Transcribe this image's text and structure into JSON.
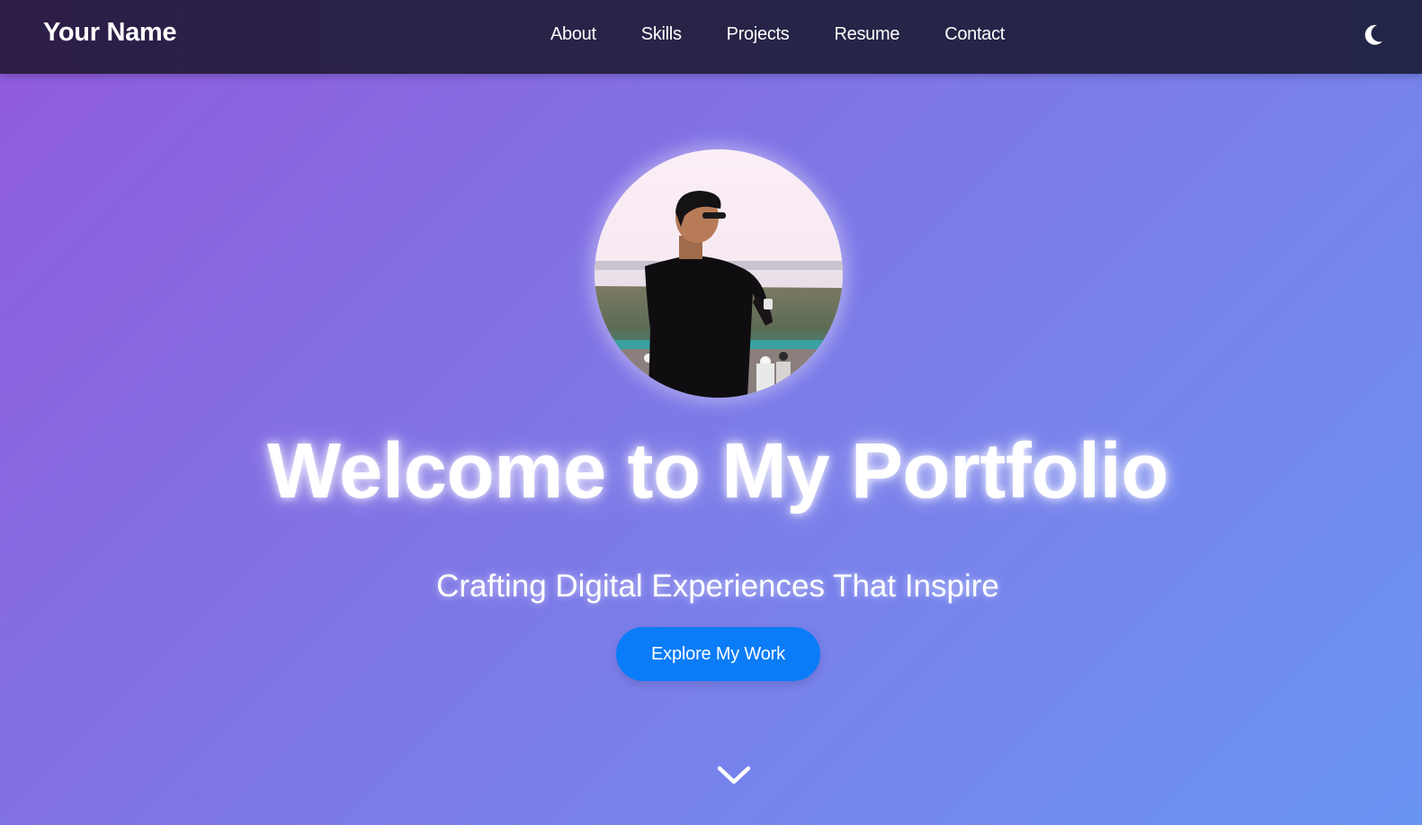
{
  "navbar": {
    "brand": "Your Name",
    "links": [
      {
        "label": "About"
      },
      {
        "label": "Skills"
      },
      {
        "label": "Projects"
      },
      {
        "label": "Resume"
      },
      {
        "label": "Contact"
      }
    ],
    "theme_toggle_icon": "moon-icon"
  },
  "hero": {
    "profile_photo": "profile-photo",
    "title": "Welcome to My Portfolio",
    "subtitle": "Crafting Digital Experiences That Inspire",
    "cta_label": "Explore My Work",
    "scroll_icon": "chevron-down-icon"
  },
  "colors": {
    "navbar_bg": "#282347",
    "gradient_start": "#9059dc",
    "gradient_end": "#6a94f4",
    "cta_bg": "#0a7cf7",
    "text": "#ffffff"
  }
}
